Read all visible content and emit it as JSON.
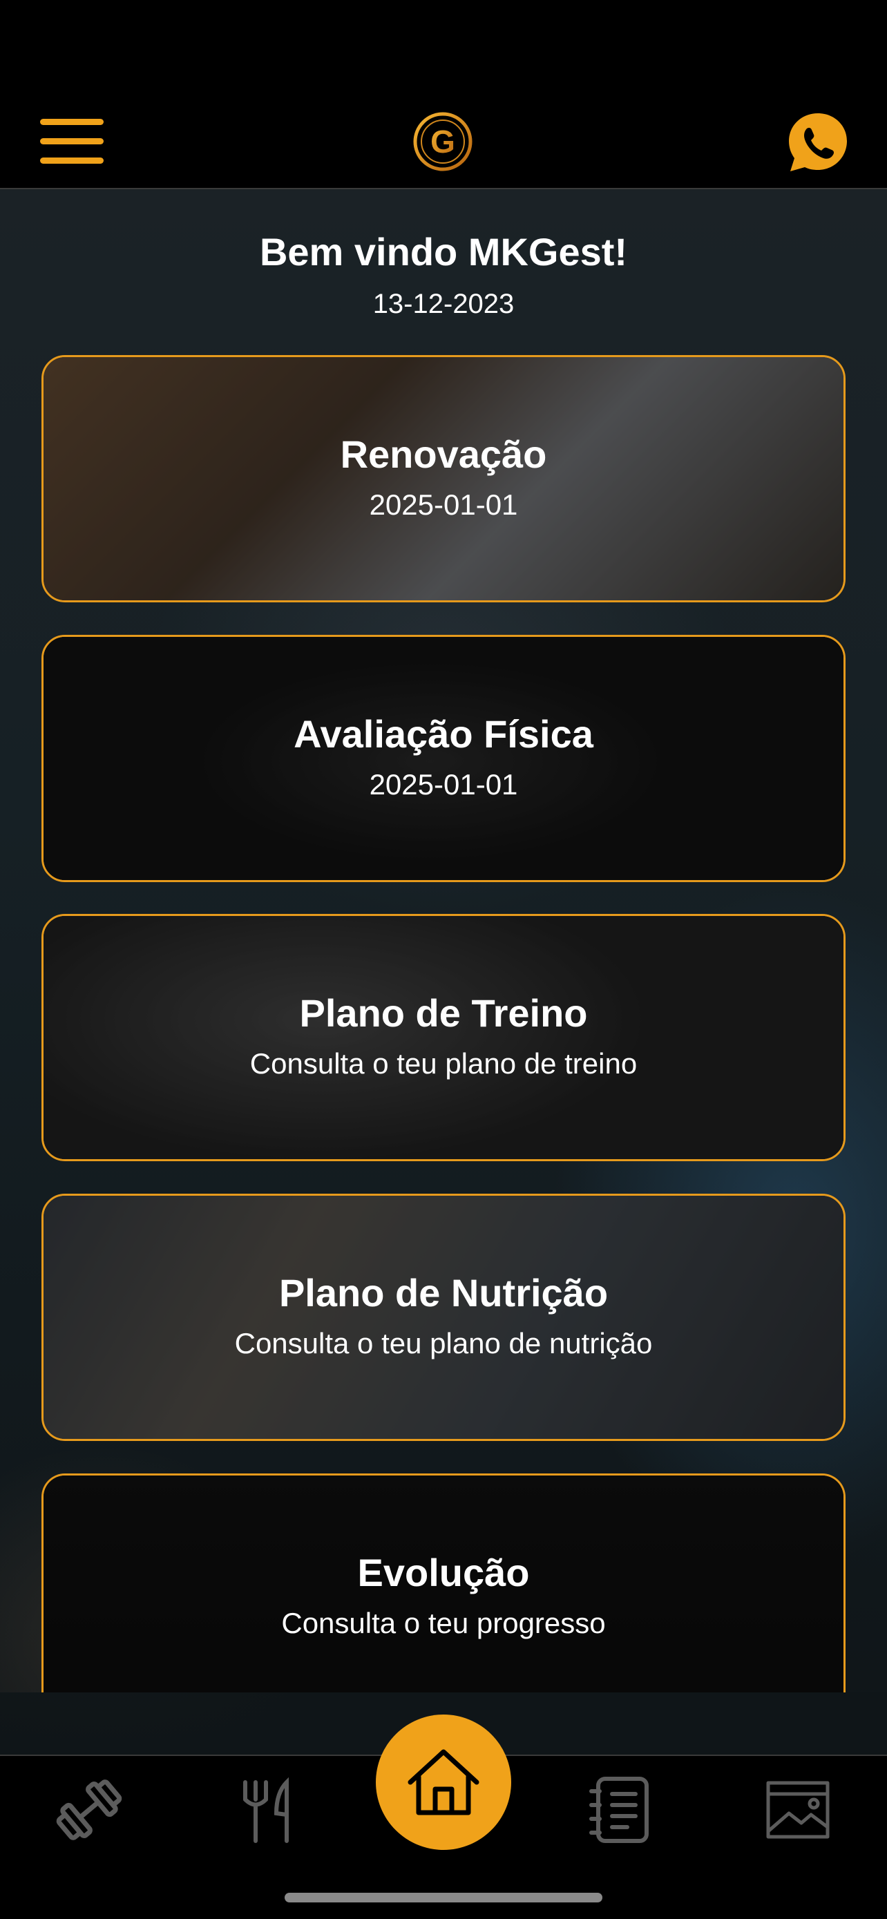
{
  "header": {
    "menu_icon": "hamburger-menu-icon",
    "logo_letter": "G",
    "contact_icon": "whatsapp-icon",
    "accent_color": "#f0a21a"
  },
  "welcome": {
    "title": "Bem vindo MKGest!",
    "date": "13-12-2023"
  },
  "cards": [
    {
      "title": "Renovação",
      "subtitle": "2025-01-01"
    },
    {
      "title": "Avaliação Física",
      "subtitle": "2025-01-01"
    },
    {
      "title": "Plano de Treino",
      "subtitle": "Consulta o teu plano de treino"
    },
    {
      "title": "Plano de Nutrição",
      "subtitle": "Consulta o teu plano de nutrição"
    },
    {
      "title": "Evolução",
      "subtitle": "Consulta o teu progresso"
    }
  ],
  "bottom_nav": {
    "items": [
      {
        "icon": "dumbbell-icon"
      },
      {
        "icon": "fork-knife-icon"
      },
      {
        "icon": "home-icon",
        "active": true
      },
      {
        "icon": "notes-list-icon"
      },
      {
        "icon": "gallery-image-icon"
      }
    ]
  }
}
